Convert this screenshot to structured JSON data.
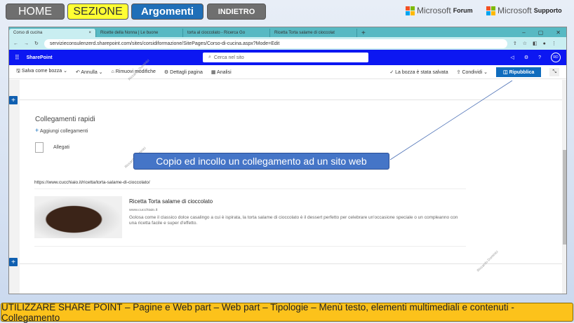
{
  "nav": {
    "home": "HOME",
    "section": "SEZIONE",
    "topics": "Argomenti",
    "back": "INDIETRO"
  },
  "ms_links": [
    {
      "brand": "Microsoft",
      "label": "Forum"
    },
    {
      "brand": "Microsoft",
      "label": "Supporto"
    }
  ],
  "browser": {
    "tabs": [
      "Corso di cucina",
      "Ricette della Nonna | Le buone",
      "torta al cioccolato - Ricerca Go",
      "Ricetta Torta salame di cioccolat"
    ],
    "url": "servizieconsulenzerd.sharepoint.com/sites/corsidiformazione/SitePages/Corso-di-cucina.aspx?Mode=Edit"
  },
  "sharepoint": {
    "app": "SharePoint",
    "search_placeholder": "Cerca nel sito",
    "avatar": "RD"
  },
  "toolbar": {
    "save_draft": "Salva come bozza",
    "undo": "Annulla",
    "discard": "Rimuovi modifiche",
    "page_details": "Dettagli pagina",
    "analytics": "Analisi",
    "saved_status": "La bozza è stata salvata",
    "share": "Condividi",
    "republish": "Ripubblica"
  },
  "quicklinks": {
    "title": "Collegamenti rapidi",
    "add": "Aggiungi collegamenti",
    "item": "Allegati"
  },
  "link": {
    "url": "https://www.cucchiaio.it/ricetta/torta-salame-di-cioccolato/",
    "title": "Ricetta Torta salame di cioccolato",
    "site": "www.cucchiaio.it",
    "description": "Golosa come il classico dolce casalingo a cui è ispirata, la torta salame di cioccolato è il dessert perfetto per celebrare un'occasione speciale o un compleanno con una ricetta facile e super d'effetto."
  },
  "callout": "Copio ed incollo un collegamento ad un sito web",
  "watermark": "Riccardo Dominici",
  "footer": "UTILIZZARE SHARE POINT – Pagine e Web part – Web part – Tipologie – Menù testo, elementi multimediali e contenuti - Collegamento"
}
